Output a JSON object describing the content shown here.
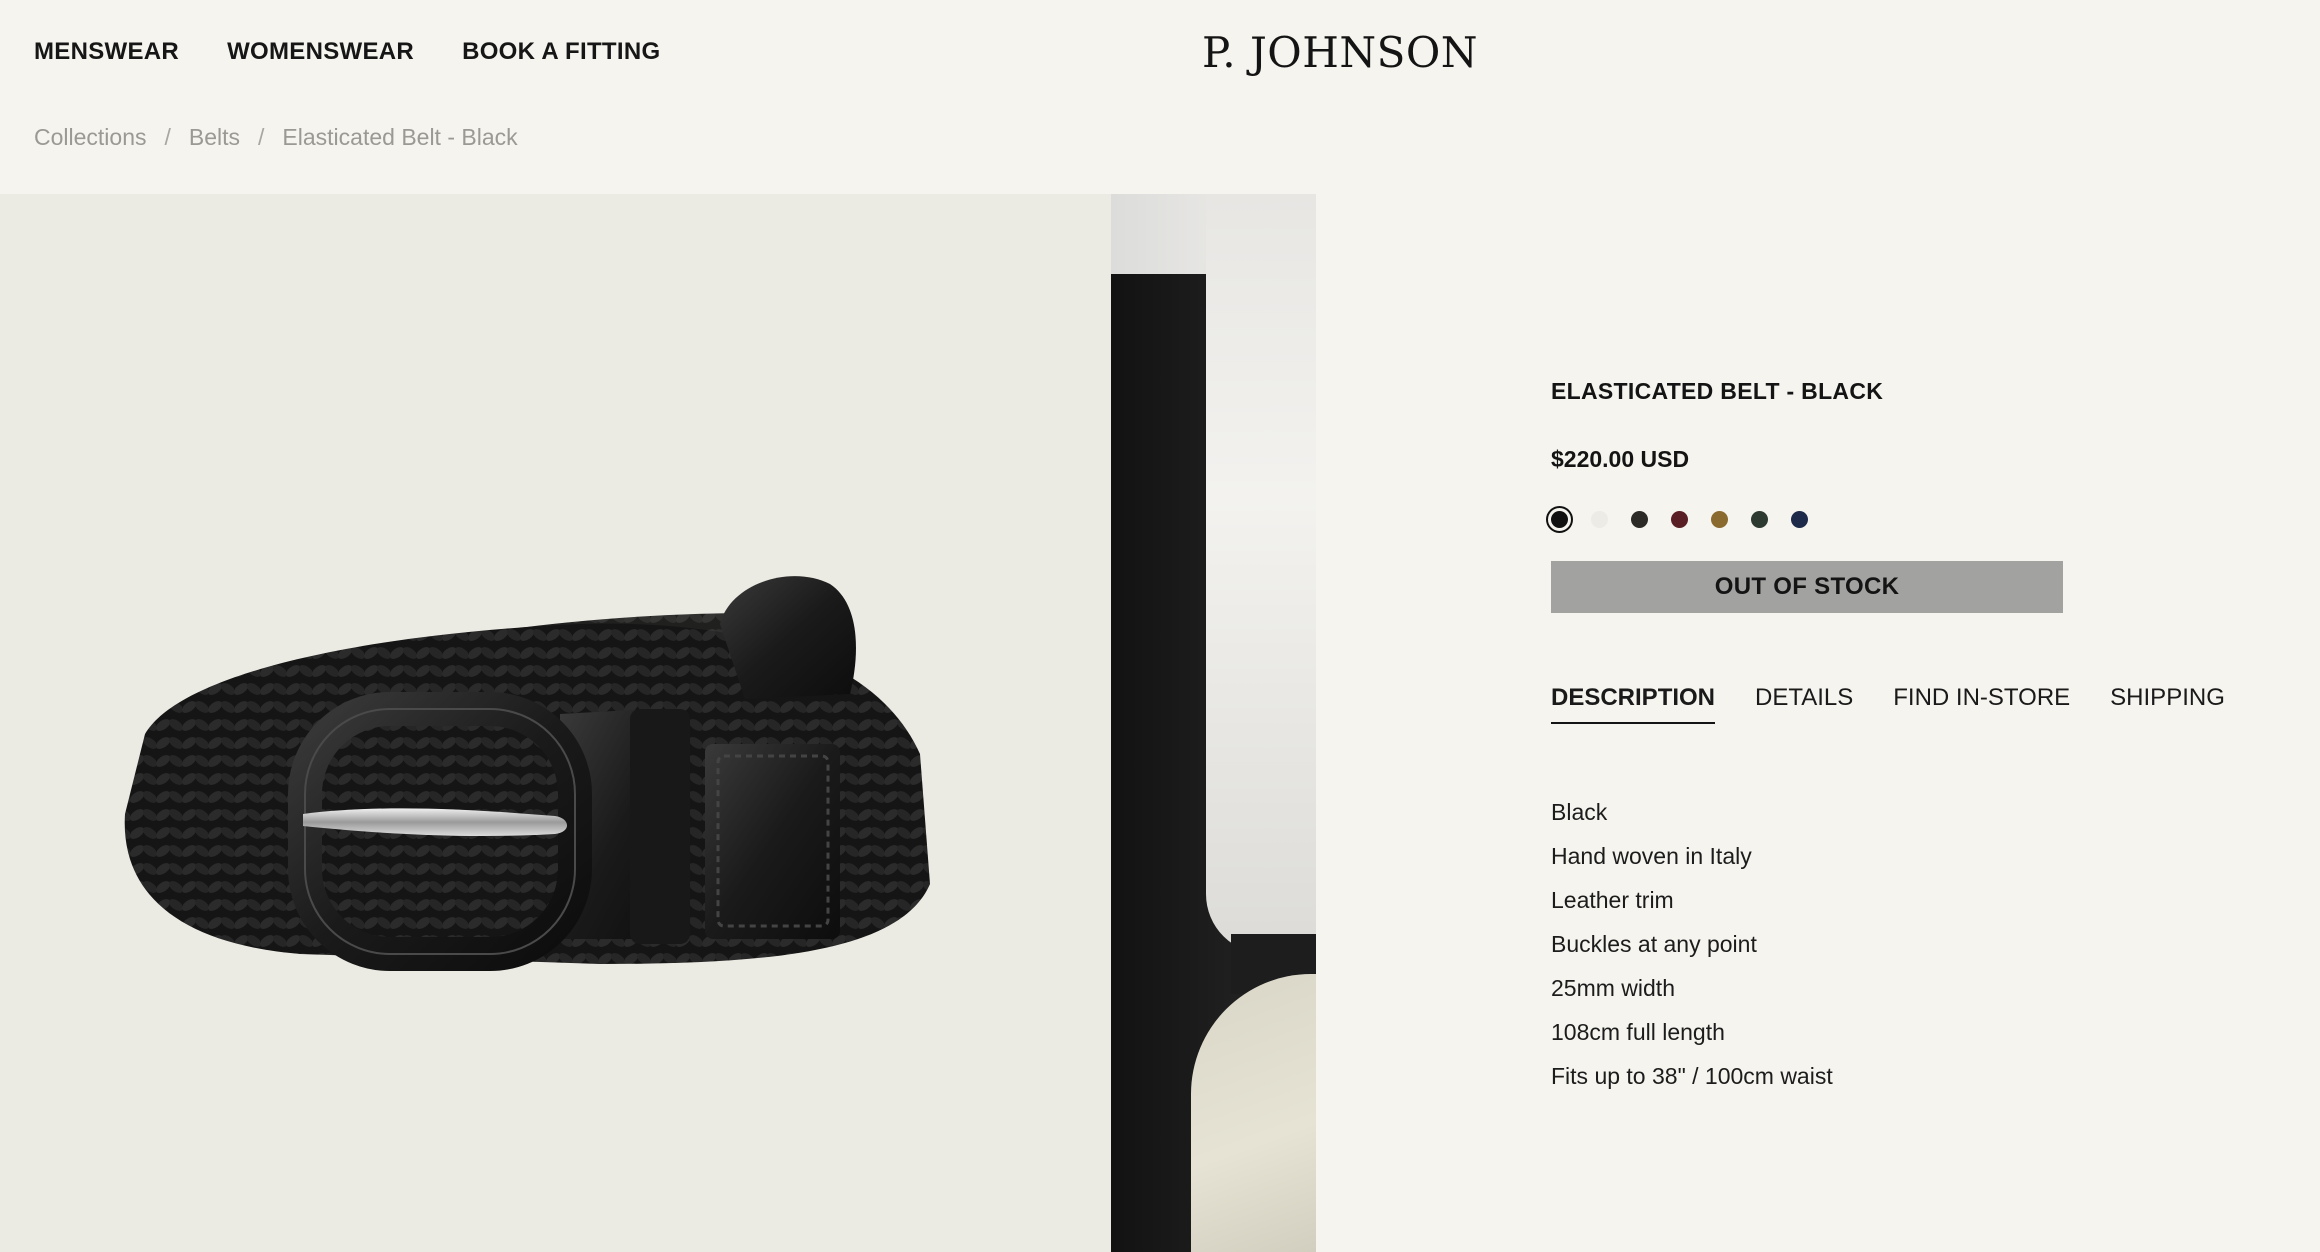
{
  "nav": {
    "menswear": "MENSWEAR",
    "womenswear": "WOMENSWEAR",
    "book_fitting": "BOOK A FITTING"
  },
  "brand": {
    "logo": "P. JOHNSON"
  },
  "breadcrumb": {
    "items": [
      "Collections",
      "Belts",
      "Elasticated Belt - Black"
    ],
    "separator": "/"
  },
  "product": {
    "title": "ELASTICATED BELT - BLACK",
    "price": "$220.00 USD",
    "colors": [
      {
        "name": "black",
        "hex": "#111111",
        "selected": true
      },
      {
        "name": "white",
        "hex": "#ecebe6",
        "selected": false
      },
      {
        "name": "charcoal",
        "hex": "#2b2a26",
        "selected": false
      },
      {
        "name": "burgundy",
        "hex": "#5a1f25",
        "selected": false
      },
      {
        "name": "tan",
        "hex": "#8a6a2e",
        "selected": false
      },
      {
        "name": "dark-green",
        "hex": "#2c3a32",
        "selected": false
      },
      {
        "name": "navy",
        "hex": "#1d2a4a",
        "selected": false
      }
    ],
    "stock_button": "OUT OF STOCK"
  },
  "tabs": [
    {
      "label": "DESCRIPTION",
      "active": true
    },
    {
      "label": "DETAILS",
      "active": false
    },
    {
      "label": "FIND IN-STORE",
      "active": false
    },
    {
      "label": "SHIPPING",
      "active": false
    }
  ],
  "description": [
    "Black",
    "Hand woven in Italy",
    "Leather trim",
    "Buckles at any point",
    "25mm width",
    "108cm full length",
    "Fits up to 38\" / 100cm waist"
  ]
}
